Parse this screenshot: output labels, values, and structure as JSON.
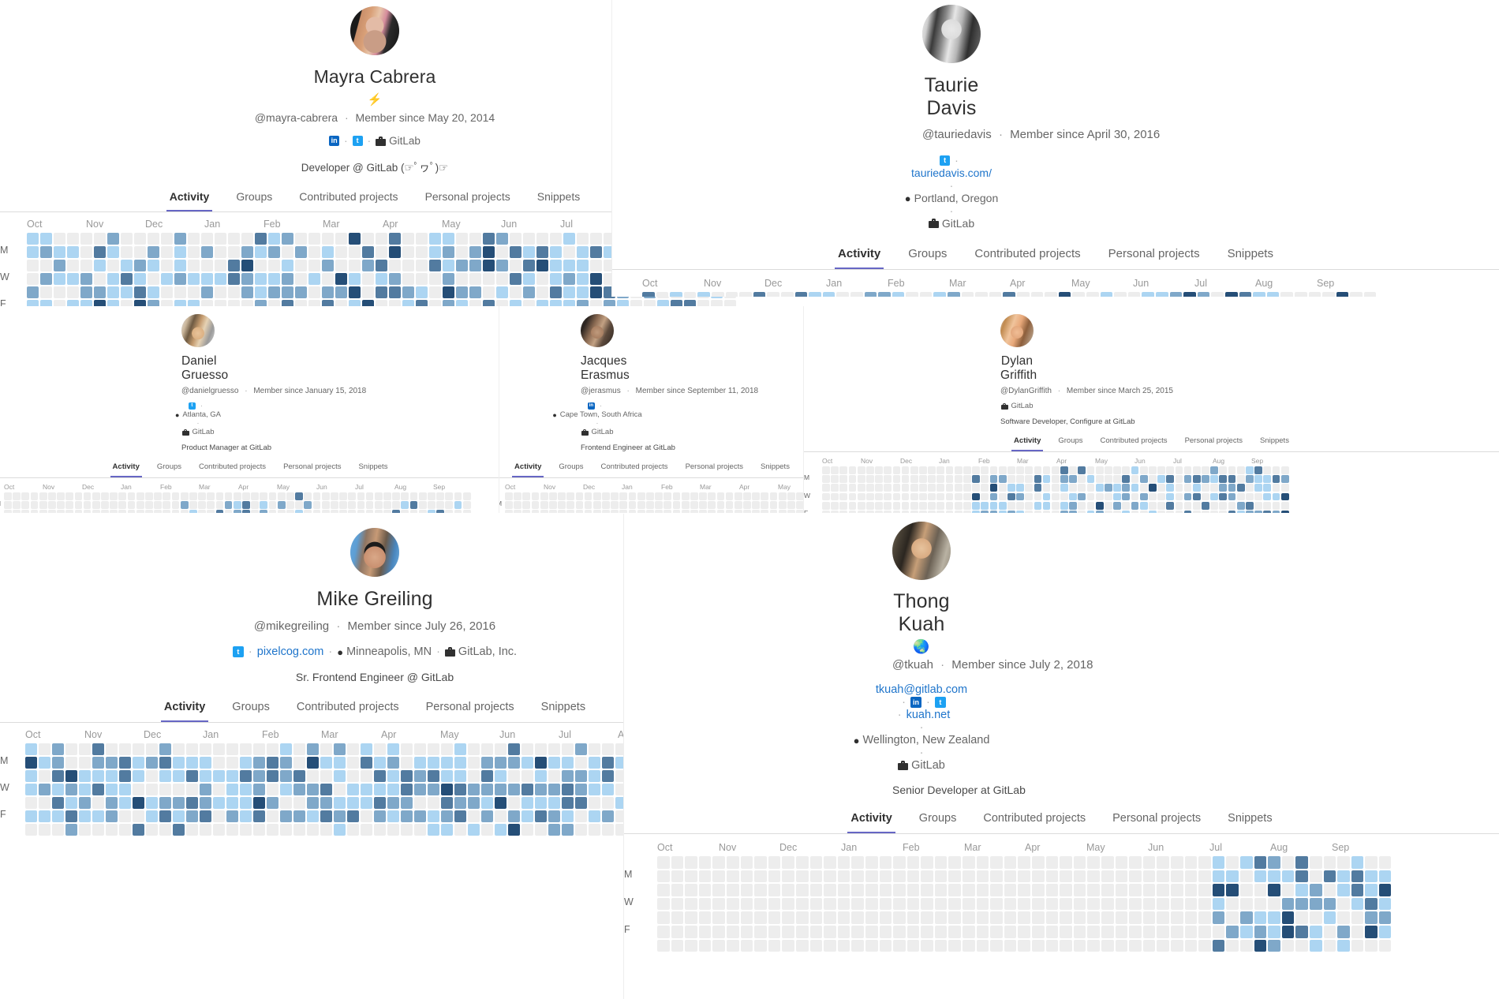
{
  "theme": {
    "link": "#1f75cb",
    "tab_active_underline": "#6666c4",
    "text": "#303030",
    "muted": "#666666",
    "heat_levels": [
      "#ededed",
      "#acd5f2",
      "#7fa8c9",
      "#527ba0",
      "#254e77"
    ]
  },
  "calendar": {
    "months": [
      "Oct",
      "Nov",
      "Dec",
      "Jan",
      "Feb",
      "Mar",
      "Apr",
      "May",
      "Jun",
      "Jul",
      "Aug",
      "Sep"
    ],
    "day_labels": [
      "M",
      "W",
      "F"
    ]
  },
  "profiles": [
    {
      "id": "mayra-cabrera",
      "name": "Mayra Cabrera",
      "status_emoji": "⚡",
      "username": "@mayra-cabrera",
      "member_since": "Member since May 20, 2014",
      "links": [
        {
          "type": "linkedin-icon",
          "label": ""
        },
        {
          "type": "twitter-icon",
          "label": ""
        },
        {
          "type": "organization",
          "label": "GitLab"
        }
      ],
      "bio": "Developer @ GitLab (☞ﾟヮﾟ)☞",
      "tabs": [
        "Activity",
        "Groups",
        "Contributed projects",
        "Personal projects",
        "Snippets"
      ],
      "active_tab": "Activity"
    },
    {
      "id": "tauriedavis",
      "name": "Taurie Davis",
      "status_emoji": "",
      "username": "@tauriedavis",
      "member_since": "Member since April 30, 2016",
      "links": [
        {
          "type": "twitter-icon",
          "label": ""
        },
        {
          "type": "website",
          "label": "tauriedavis.com/"
        },
        {
          "type": "location",
          "label": "Portland, Oregon"
        },
        {
          "type": "organization",
          "label": "GitLab"
        }
      ],
      "bio": "",
      "tabs": [
        "Activity",
        "Groups",
        "Contributed projects",
        "Personal projects",
        "Snippets"
      ],
      "active_tab": "Activity"
    },
    {
      "id": "danielgruesso",
      "name": "Daniel Gruesso",
      "status_emoji": "",
      "username": "@danielgruesso",
      "member_since": "Member since January 15, 2018",
      "links": [
        {
          "type": "twitter-icon",
          "label": ""
        },
        {
          "type": "location",
          "label": "Atlanta, GA"
        },
        {
          "type": "organization",
          "label": "GitLab"
        }
      ],
      "bio": "Product Manager at GitLab",
      "tabs": [
        "Activity",
        "Groups",
        "Contributed projects",
        "Personal projects",
        "Snippets"
      ],
      "active_tab": "Activity"
    },
    {
      "id": "jerasmus",
      "name": "Jacques Erasmus",
      "status_emoji": "",
      "username": "@jerasmus",
      "member_since": "Member since September 11, 2018",
      "links": [
        {
          "type": "linkedin-icon",
          "label": ""
        },
        {
          "type": "location",
          "label": "Cape Town, South Africa"
        },
        {
          "type": "organization",
          "label": "GitLab"
        }
      ],
      "bio": "Frontend Engineer at GitLab",
      "tabs": [
        "Activity",
        "Groups",
        "Contributed projects",
        "Personal projects",
        "Snippets"
      ],
      "active_tab": "Activity"
    },
    {
      "id": "DylanGriffith",
      "name": "Dylan Griffith",
      "status_emoji": "",
      "username": "@DylanGriffith",
      "member_since": "Member since March 25, 2015",
      "links": [
        {
          "type": "organization",
          "label": "GitLab"
        }
      ],
      "bio": "Software Developer, Configure at GitLab",
      "tabs": [
        "Activity",
        "Groups",
        "Contributed projects",
        "Personal projects",
        "Snippets"
      ],
      "active_tab": "Activity"
    },
    {
      "id": "mikegreiling",
      "name": "Mike Greiling",
      "status_emoji": "",
      "username": "@mikegreiling",
      "member_since": "Member since July 26, 2016",
      "links": [
        {
          "type": "twitter-icon",
          "label": ""
        },
        {
          "type": "website",
          "label": "pixelcog.com"
        },
        {
          "type": "location",
          "label": "Minneapolis, MN"
        },
        {
          "type": "organization",
          "label": "GitLab, Inc."
        }
      ],
      "bio": "Sr. Frontend Engineer @ GitLab",
      "tabs": [
        "Activity",
        "Groups",
        "Contributed projects",
        "Personal projects",
        "Snippets"
      ],
      "active_tab": "Activity"
    },
    {
      "id": "tkuah",
      "name": "Thong Kuah",
      "status_emoji": "🌏",
      "username": "@tkuah",
      "member_since": "Member since July 2, 2018",
      "links": [
        {
          "type": "email",
          "label": "tkuah@gitlab.com"
        },
        {
          "type": "linkedin-icon",
          "label": ""
        },
        {
          "type": "twitter-icon",
          "label": ""
        },
        {
          "type": "website",
          "label": "kuah.net"
        },
        {
          "type": "location",
          "label": "Wellington, New Zealand"
        },
        {
          "type": "organization",
          "label": "GitLab"
        }
      ],
      "bio": "Senior Developer at GitLab",
      "tabs": [
        "Activity",
        "Groups",
        "Contributed projects",
        "Personal projects",
        "Snippets"
      ],
      "active_tab": "Activity"
    }
  ]
}
